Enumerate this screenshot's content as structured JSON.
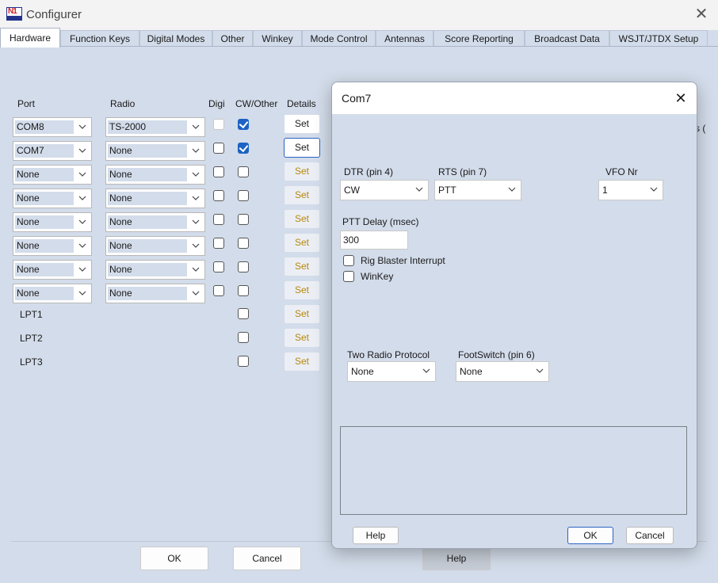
{
  "window": {
    "title": "Configurer",
    "icon": "n1mm-logo-icon",
    "icon_text": "N1"
  },
  "tabs": [
    "Hardware",
    "Function Keys",
    "Digital Modes",
    "Other",
    "Winkey",
    "Mode Control",
    "Antennas",
    "Score Reporting",
    "Broadcast Data",
    "WSJT/JTDX Setup"
  ],
  "active_tab": "Hardware",
  "columns": {
    "port": "Port",
    "radio": "Radio",
    "digi": "Digi",
    "cw_other": "CW/Other",
    "details": "Details"
  },
  "rows": [
    {
      "port": "COM8",
      "radio": "TS-2000",
      "digi": false,
      "cw": true,
      "set": "Set"
    },
    {
      "port": "COM7",
      "radio": "None",
      "digi": false,
      "cw": true,
      "set": "Set"
    },
    {
      "port": "None",
      "radio": "None",
      "digi": false,
      "cw": false,
      "set": "Set"
    },
    {
      "port": "None",
      "radio": "None",
      "digi": false,
      "cw": false,
      "set": "Set"
    },
    {
      "port": "None",
      "radio": "None",
      "digi": false,
      "cw": false,
      "set": "Set"
    },
    {
      "port": "None",
      "radio": "None",
      "digi": false,
      "cw": false,
      "set": "Set"
    },
    {
      "port": "None",
      "radio": "None",
      "digi": false,
      "cw": false,
      "set": "Set"
    },
    {
      "port": "None",
      "radio": "None",
      "digi": false,
      "cw": false,
      "set": "Set"
    }
  ],
  "lpt_rows": [
    {
      "label": "LPT1",
      "cw": false,
      "set": "Set"
    },
    {
      "label": "LPT2",
      "cw": false,
      "set": "Set"
    },
    {
      "label": "LPT3",
      "cw": false,
      "set": "Set"
    }
  ],
  "clipped_text": "s (",
  "buttons": {
    "ok": "OK",
    "cancel": "Cancel",
    "help": "Help"
  },
  "dialog": {
    "title": "Com7",
    "dtr_label": "DTR (pin 4)",
    "dtr_value": "CW",
    "rts_label": "RTS (pin 7)",
    "rts_value": "PTT",
    "vfo_label": "VFO Nr",
    "vfo_value": "1",
    "ptt_delay_label": "PTT Delay  (msec)",
    "ptt_delay_value": "300",
    "rig_blaster_label": "Rig Blaster Interrupt",
    "rig_blaster_checked": false,
    "winkey_label": "WinKey",
    "winkey_checked": false,
    "two_radio_label": "Two Radio Protocol",
    "two_radio_value": "None",
    "footswitch_label": "FootSwitch (pin 6)",
    "footswitch_value": "None",
    "help": "Help",
    "ok": "OK",
    "cancel": "Cancel"
  },
  "colors": {
    "panel": "#d3dcea",
    "accent": "#1d62c4",
    "set_disabled_text": "#b8860b"
  }
}
